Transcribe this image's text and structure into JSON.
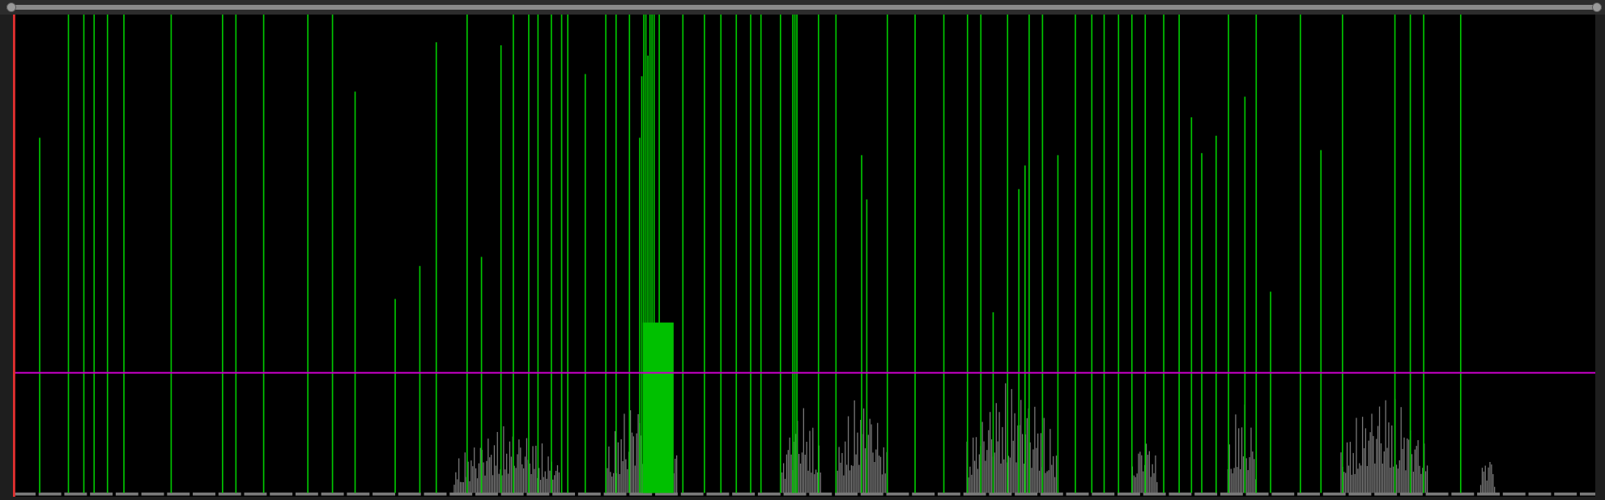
{
  "scrollbar": {
    "kind": "horizontal"
  },
  "display": {
    "kind": "onset-plot"
  }
}
